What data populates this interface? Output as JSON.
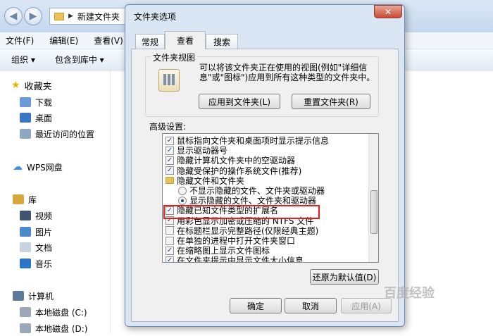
{
  "explorer": {
    "address": "新建文件夹",
    "menu": [
      "文件(F)",
      "编辑(E)",
      "查看(V)",
      "工"
    ],
    "toolbar": {
      "organize": "组织 ▾",
      "include": "包含到库中 ▾"
    },
    "nav": {
      "favorites": "收藏夹",
      "downloads": "下载",
      "desktop": "桌面",
      "recent": "最近访问的位置",
      "wps": "WPS网盘",
      "library": "库",
      "video": "视频",
      "pictures": "图片",
      "docs": "文档",
      "music": "音乐",
      "computer": "计算机",
      "disk_c": "本地磁盘 (C:)",
      "disk_d": "本地磁盘 (D:)"
    }
  },
  "dialog": {
    "title": "文件夹选项",
    "close": "✕",
    "tabs": [
      "常规",
      "查看",
      "搜索"
    ],
    "folder_views": {
      "label": "文件夹视图",
      "desc": "可以将该文件夹正在使用的视图(例如\"详细信息\"或\"图标\")应用到所有这种类型的文件夹中。",
      "apply_btn": "应用到文件夹(L)",
      "reset_btn": "重置文件夹(R)"
    },
    "advanced_label": "高级设置:",
    "settings": [
      {
        "kind": "check",
        "checked": true,
        "label": "鼠标指向文件夹和桌面项时显示提示信息"
      },
      {
        "kind": "check",
        "checked": true,
        "label": "显示驱动器号"
      },
      {
        "kind": "check",
        "checked": true,
        "label": "隐藏计算机文件夹中的空驱动器"
      },
      {
        "kind": "check",
        "checked": true,
        "label": "隐藏受保护的操作系统文件(推荐)"
      },
      {
        "kind": "folder",
        "checked": false,
        "label": "隐藏文件和文件夹"
      },
      {
        "kind": "radio",
        "checked": false,
        "label": "不显示隐藏的文件、文件夹或驱动器"
      },
      {
        "kind": "radio",
        "checked": true,
        "label": "显示隐藏的文件、文件夹和驱动器"
      },
      {
        "kind": "check",
        "checked": true,
        "label": "隐藏已知文件类型的扩展名"
      },
      {
        "kind": "check",
        "checked": true,
        "label": "用彩色显示加密或压缩的 NTFS 文件"
      },
      {
        "kind": "check",
        "checked": false,
        "label": "在标题栏显示完整路径(仅限经典主题)"
      },
      {
        "kind": "check",
        "checked": false,
        "label": "在单独的进程中打开文件夹窗口"
      },
      {
        "kind": "check",
        "checked": true,
        "label": "在缩略图上显示文件图标"
      },
      {
        "kind": "check",
        "checked": true,
        "label": "在文件夹提示中显示文件大小信息"
      }
    ],
    "restore_btn": "还原为默认值(D)",
    "ok": "确定",
    "cancel": "取消",
    "apply": "应用(A)"
  },
  "watermark": "百度经验"
}
